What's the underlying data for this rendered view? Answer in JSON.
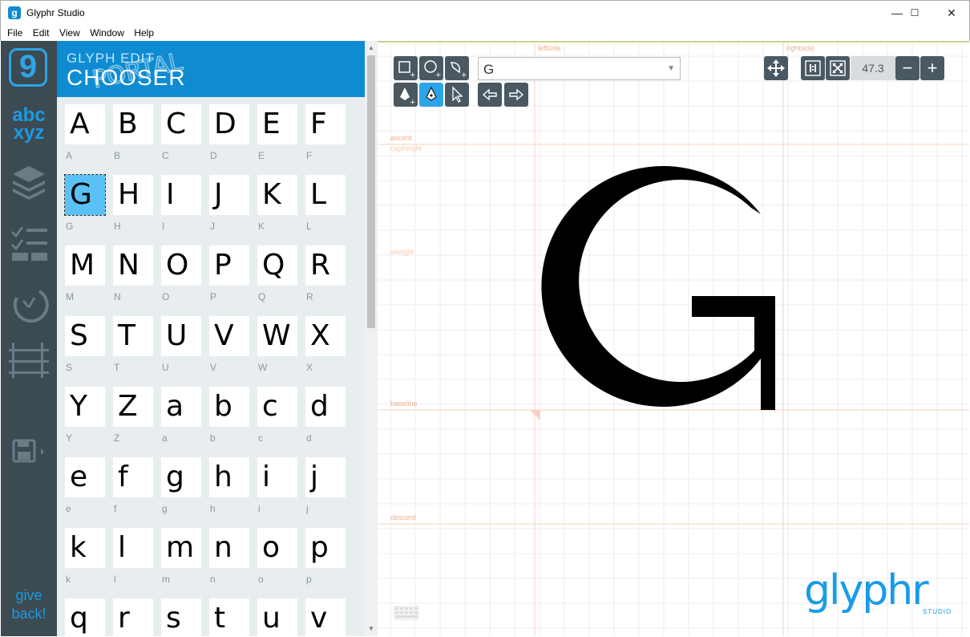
{
  "window": {
    "title": "Glyphr Studio",
    "minimize": "—",
    "maximize": "☐",
    "close": "✕"
  },
  "menu": [
    "File",
    "Edit",
    "View",
    "Window",
    "Help"
  ],
  "rail": {
    "logo": "9",
    "abc_top": "abc",
    "abc_bottom": "xyz",
    "give_line1": "give",
    "give_line2": "back!"
  },
  "panel": {
    "subtitle": "GLYPH EDIT",
    "title": "CHOOSER"
  },
  "glyphs": [
    "A",
    "B",
    "C",
    "D",
    "E",
    "F",
    "G",
    "H",
    "I",
    "J",
    "K",
    "L",
    "M",
    "N",
    "O",
    "P",
    "Q",
    "R",
    "S",
    "T",
    "U",
    "V",
    "W",
    "X",
    "Y",
    "Z",
    "a",
    "b",
    "c",
    "d",
    "e",
    "f",
    "g",
    "h",
    "i",
    "j",
    "k",
    "l",
    "m",
    "n",
    "o",
    "p",
    "q",
    "r",
    "s",
    "t",
    "u",
    "v"
  ],
  "selected_glyph": "G",
  "toolbar": {
    "glyph_select_value": "G",
    "zoom": "47.3"
  },
  "guides": {
    "leftside": "leftside",
    "rightside": "rightside",
    "ascent": "ascent",
    "capheight": "capheight",
    "xheight": "xheight",
    "baseline": "baseline",
    "descent": "descent"
  },
  "canvas_glyph": "G",
  "brand": {
    "name": "glyphr",
    "sub": "STUDIO"
  },
  "colors": {
    "accent": "#0f8bd2",
    "rail_bg": "#3c4a52",
    "panel_bg": "#e8edf0",
    "selected_tile": "#59c1f5",
    "guide": "#f0b090"
  }
}
